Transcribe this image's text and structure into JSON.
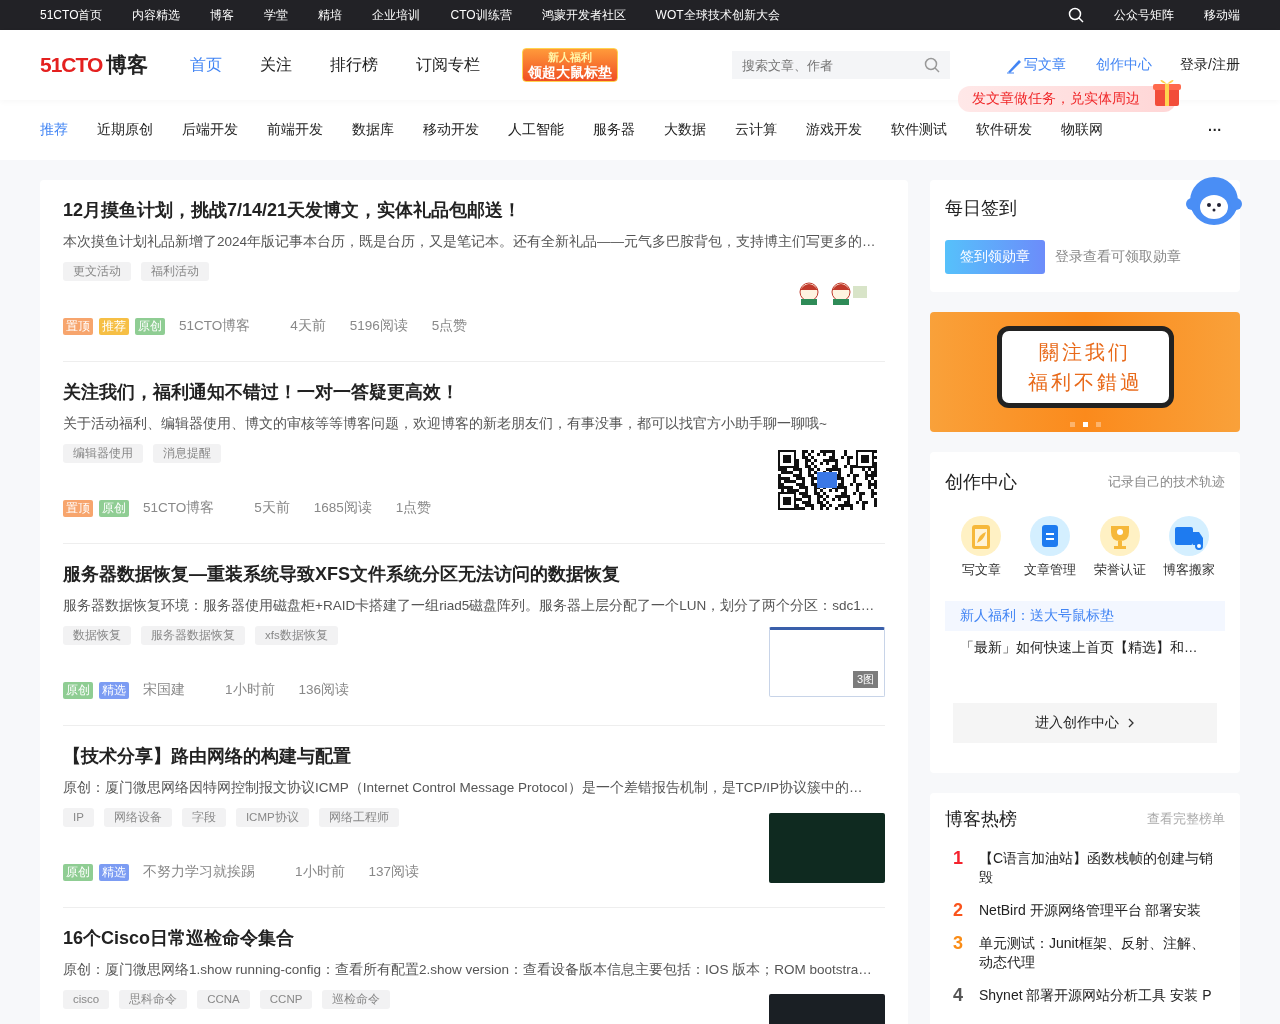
{
  "topbar": {
    "links": [
      "51CTO首页",
      "内容精选",
      "博客",
      "学堂",
      "精培",
      "企业培训",
      "CTO训练营",
      "鸿蒙开发者社区",
      "WOT全球技术创新大会"
    ],
    "right_links": [
      "公众号矩阵",
      "移动端"
    ]
  },
  "header": {
    "logo": {
      "brand": "51CTO",
      "product": "博客"
    },
    "nav": [
      {
        "label": "首页",
        "selected": true
      },
      {
        "label": "关注",
        "selected": false
      },
      {
        "label": "排行榜",
        "selected": false
      },
      {
        "label": "订阅专栏",
        "selected": false
      }
    ],
    "promo": {
      "line_1": "新人福利",
      "line_2": "领超大鼠标垫"
    },
    "search": {
      "placeholder": "搜索文章、作者"
    },
    "write": "写文章",
    "creator_center": "创作中心",
    "login": "登录/注册",
    "bubble": "发文章做任务，兑实体周边"
  },
  "categories": {
    "items": [
      {
        "label": "推荐",
        "selected": true
      },
      {
        "label": "近期原创",
        "selected": false
      },
      {
        "label": "后端开发",
        "selected": false
      },
      {
        "label": "前端开发",
        "selected": false
      },
      {
        "label": "数据库",
        "selected": false
      },
      {
        "label": "移动开发",
        "selected": false
      },
      {
        "label": "人工智能",
        "selected": false
      },
      {
        "label": "服务器",
        "selected": false
      },
      {
        "label": "大数据",
        "selected": false
      },
      {
        "label": "云计算",
        "selected": false
      },
      {
        "label": "游戏开发",
        "selected": false
      },
      {
        "label": "软件测试",
        "selected": false
      },
      {
        "label": "软件研发",
        "selected": false
      },
      {
        "label": "物联网",
        "selected": false
      }
    ],
    "more": "···"
  },
  "articles": [
    {
      "title": "12月摸鱼计划，挑战7/14/21天发博文，实体礼品包邮送！",
      "summary": "本次摸鱼计划礼品新增了2024年版记事本台历，既是台历，又是笔记本。还有全新礼品——元气多巴胺背包，支持博主们写更多的…",
      "tags": [
        "更文活动",
        "福利活动"
      ],
      "badges": [
        {
          "kind": "top",
          "label": "置顶"
        },
        {
          "kind": "recommend",
          "label": "推荐"
        },
        {
          "kind": "original",
          "label": "原创"
        }
      ],
      "author": "51CTO博客",
      "time": "4天前",
      "reads": "5196阅读",
      "likes": "5点赞",
      "thumb": {
        "kind": "figures"
      }
    },
    {
      "title": "关注我们，福利通知不错过！一对一答疑更高效！",
      "summary": "关于活动福利、编辑器使用、博文的审核等等博客问题，欢迎博客的新老朋友们，有事没事，都可以找官方小助手聊一聊哦~",
      "tags": [
        "编辑器使用",
        "消息提醒"
      ],
      "badges": [
        {
          "kind": "top",
          "label": "置顶"
        },
        {
          "kind": "original",
          "label": "原创"
        }
      ],
      "author": "51CTO博客",
      "time": "5天前",
      "reads": "1685阅读",
      "likes": "1点赞",
      "thumb": {
        "kind": "qr"
      }
    },
    {
      "title": "服务器数据恢复—重装系统导致XFS文件系统分区无法访问的数据恢复",
      "summary": "服务器数据恢复环境：服务器使用磁盘柜+RAID卡搭建了一组riad5磁盘阵列。服务器上层分配了一个LUN，划分了两个分区：sdc1…",
      "tags": [
        "数据恢复",
        "服务器数据恢复",
        "xfs数据恢复"
      ],
      "badges": [
        {
          "kind": "original",
          "label": "原创"
        },
        {
          "kind": "featured",
          "label": "精选"
        }
      ],
      "author": "宋国建",
      "time": "1小时前",
      "reads": "136阅读",
      "thumb": {
        "kind": "screenshot",
        "count": "3图"
      }
    },
    {
      "title": "【技术分享】路由网络的构建与配置",
      "summary": "原创：厦门微思网络因特网控制报文协议ICMP（Internet Control Message Protocol）是一个差错报告机制，是TCP/IP协议簇中的…",
      "tags": [
        "IP",
        "网络设备",
        "字段",
        "ICMP协议",
        "网络工程师"
      ],
      "badges": [
        {
          "kind": "original",
          "label": "原创"
        },
        {
          "kind": "featured",
          "label": "精选"
        }
      ],
      "author": "不努力学习就挨踢",
      "time": "1小时前",
      "reads": "137阅读",
      "thumb": {
        "kind": "dark"
      }
    },
    {
      "title": "16个Cisco日常巡检命令集合",
      "summary": "原创：厦门微思网络1.show running-config：查看所有配置2.show version：查看设备版本信息主要包括：IOS 版本；ROM bootstra…",
      "tags": [
        "cisco",
        "思科命令",
        "CCNA",
        "CCNP",
        "巡检命令"
      ],
      "thumb": {
        "kind": "photo"
      }
    }
  ],
  "signin": {
    "title": "每日签到",
    "button": "签到领勋章",
    "hint": "登录查看可领取勋章"
  },
  "banner": {
    "line_1": "關注我们",
    "line_2": "福利不錯過",
    "dots": [
      {
        "selected": false
      },
      {
        "selected": true
      },
      {
        "selected": false
      }
    ]
  },
  "creator": {
    "title": "创作中心",
    "subtitle": "记录自己的技术轨迹",
    "tools": [
      {
        "kind": "write",
        "label": "写文章"
      },
      {
        "kind": "manage",
        "label": "文章管理"
      },
      {
        "kind": "honor",
        "label": "荣誉认证"
      },
      {
        "kind": "move",
        "label": "博客搬家"
      }
    ],
    "notice": "新人福利：送大号鼠标垫",
    "news": "「最新」如何快速上首页【精选】和…",
    "button": "进入创作中心"
  },
  "hotlist": {
    "title": "博客热榜",
    "more": "查看完整榜单",
    "items": [
      {
        "rank": "1",
        "title": "【C语言加油站】函数栈帧的创建与销毁"
      },
      {
        "rank": "2",
        "title": "NetBird 开源网络管理平台 部署安装"
      },
      {
        "rank": "3",
        "title": "单元测试：Junit框架、反射、注解、动态代理"
      },
      {
        "rank": "4",
        "title": "Shynet 部署开源网站分析工具 安装 P"
      }
    ]
  }
}
